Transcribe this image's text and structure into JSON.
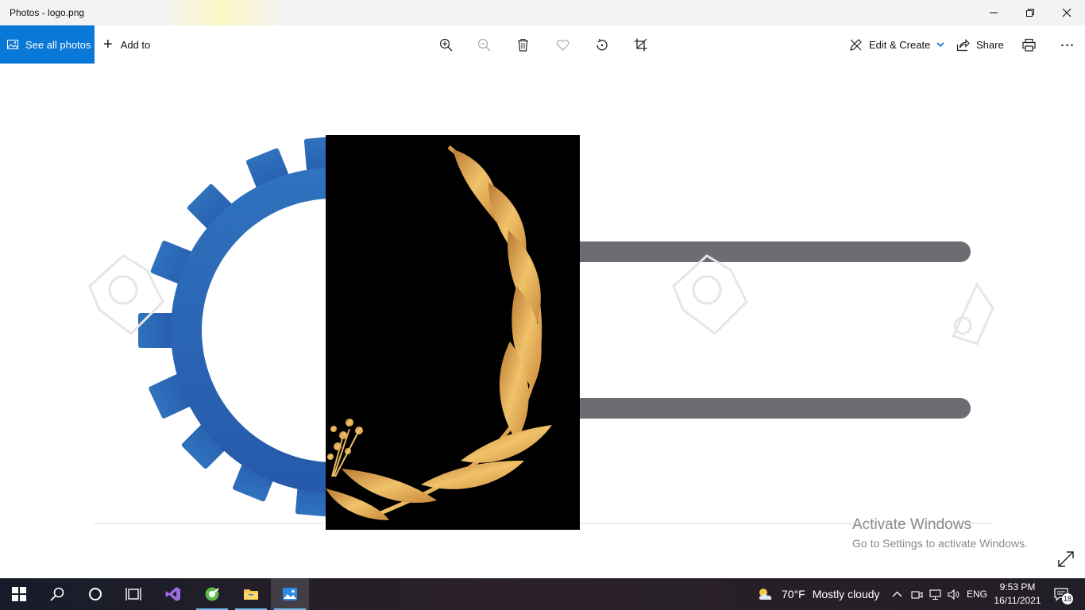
{
  "window": {
    "title": "Photos - logo.png"
  },
  "commandbar": {
    "see_all_label": "See all photos",
    "add_to_label": "Add to",
    "edit_create_label": "Edit & Create",
    "share_label": "Share"
  },
  "watermark": {
    "heading": "Activate Windows",
    "subtext": "Go to Settings to activate Windows."
  },
  "taskbar": {
    "weather_temp": "70°F",
    "weather_desc": "Mostly cloudy",
    "language": "ENG",
    "time": "9:53 PM",
    "date": "16/11/2021",
    "notification_count": "18"
  },
  "colors": {
    "accent": "#0a78d7",
    "gear_blue": "#2c6ab8",
    "bar_gray": "#6e6c72",
    "laurel_gold": "#d9a24a",
    "taskbar_bg": "#221e27"
  }
}
